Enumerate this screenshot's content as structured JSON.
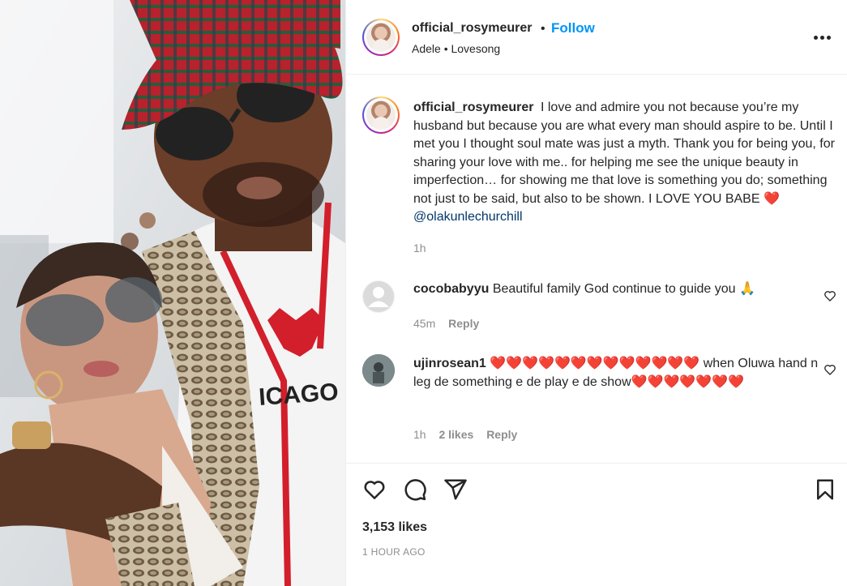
{
  "post": {
    "author": "official_rosymeurer",
    "follow_label": "Follow",
    "separator": "•",
    "audio": "Adele • Lovesong",
    "caption": "I love and admire you not because you’re my husband but because you are what every man should aspire to be. Until I met you I thought soul mate was just a myth. Thank you for being you, for sharing your love with me.. for helping me see the unique beauty in imperfection… for showing me that love is something you do; something not just to be said, but also to be shown. I LOVE YOU BABE",
    "caption_heart": "❤️",
    "mention": "@olakunlechurchill",
    "caption_time": "1h"
  },
  "comments": [
    {
      "user": "cocobabyyu",
      "text": "Beautiful family God continue to guide you 🙏",
      "time": "45m",
      "reply_label": "Reply"
    },
    {
      "user": "ujinrosean1",
      "text": "❤️❤️❤️❤️❤️❤️❤️❤️❤️❤️❤️❤️❤️ when Oluwa hand n leg de something e de play e de show❤️❤️❤️❤️❤️❤️❤️",
      "time": "1h",
      "likes_label": "2 likes",
      "reply_label": "Reply"
    }
  ],
  "footer": {
    "likes": "3,153 likes",
    "time_ago": "1 HOUR AGO"
  },
  "icons": [
    "more-icon",
    "heart-icon",
    "comment-icon",
    "share-icon",
    "bookmark-icon"
  ],
  "colors": {
    "accent": "#0095f6",
    "text": "#262626",
    "muted": "#8e8e8e",
    "mention": "#00376b",
    "heart": "#e02020"
  }
}
